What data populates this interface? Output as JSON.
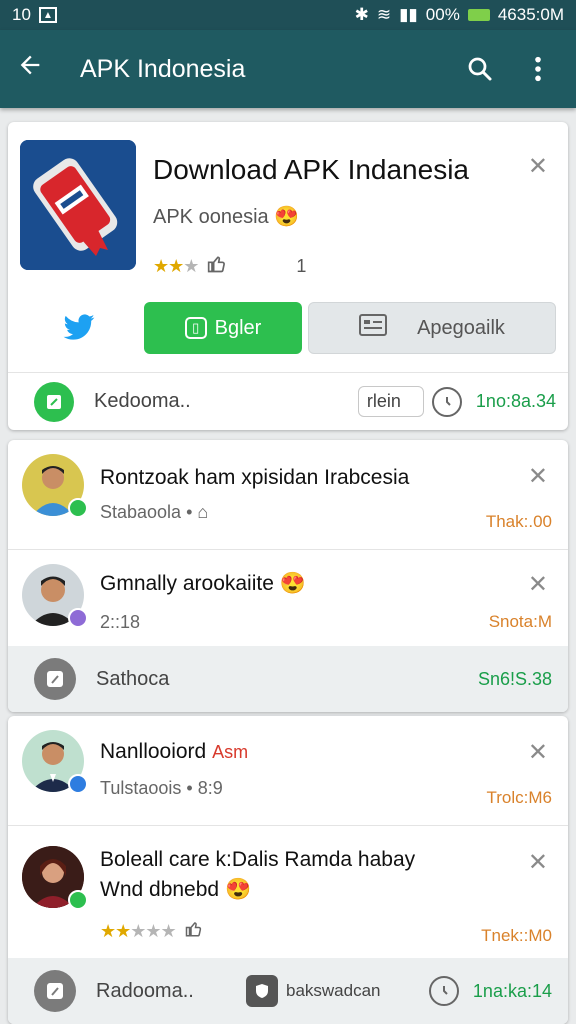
{
  "status": {
    "time_left": "10",
    "battery": "00%",
    "time_right": "4635:0M"
  },
  "appbar": {
    "title": "APK Indonesia"
  },
  "promo": {
    "title": "Download APK Indanesia",
    "subtitle": "APK oonesia",
    "emoji": "😍",
    "rating_count": "1",
    "primary_button": "Bgler",
    "secondary_button": "Apegoailk",
    "footer_label": "Kedooma..",
    "footer_pill": "rlein",
    "footer_number": "1no:8a.34"
  },
  "notifications_group1": [
    {
      "title": "Rontzoak ham xpisidan Irabcesia",
      "subtitle": "Stabaoola",
      "meta": "Thak:.00"
    },
    {
      "title": "Gmnally arookaiite",
      "emoji": "😍",
      "subtitle": "2::18",
      "meta": "Snota:M"
    }
  ],
  "group1_footer": {
    "label": "Sathoca",
    "number": "Sn6!S.38"
  },
  "notifications_group2": [
    {
      "title": "Nanllooiord",
      "title_accent": "Asm",
      "subtitle": "Tulstaoois",
      "subtitle_extra": "8:9",
      "meta": "Trolc:M6"
    },
    {
      "title": "Boleall care k:Dalis Ramda habay",
      "title_line2": "Wnd dbnebd",
      "emoji": "😍",
      "meta": "Tnek::M0"
    }
  ],
  "group2_footer": {
    "label": "Radooma..",
    "middle_label": "bakswadcan",
    "number": "1na:ka:14"
  },
  "colors": {
    "appbar": "#1f5a61",
    "green": "#2dbf4f",
    "orange_meta": "#d9822b"
  }
}
